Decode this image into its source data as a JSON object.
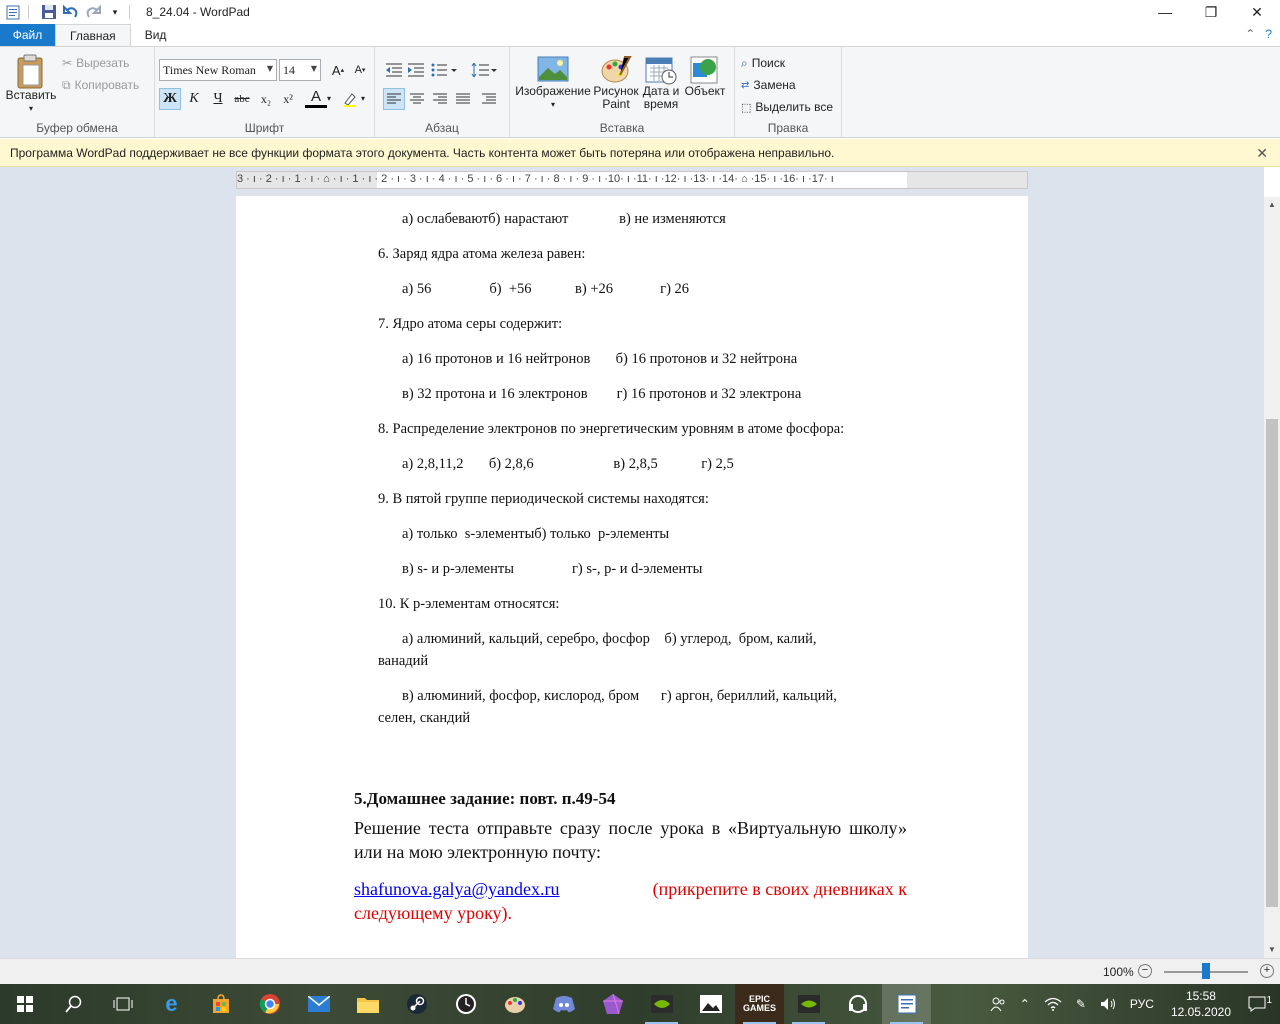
{
  "window": {
    "title": "8_24.04 - WordPad",
    "minimize": "—",
    "maximize": "❐",
    "close": "✕"
  },
  "tabs": {
    "file": "Файл",
    "home": "Главная",
    "view": "Вид"
  },
  "ribbon": {
    "clipboard": {
      "label": "Буфер обмена",
      "paste": "Вставить",
      "cut": "Вырезать",
      "copy": "Копировать"
    },
    "font": {
      "label": "Шрифт",
      "family": "Times New Roman",
      "size": "14",
      "bold": "Ж",
      "italic": "К",
      "underline": "Ч",
      "strike": "abc",
      "subscript": "x₂",
      "superscript": "x²",
      "color_letter": "A"
    },
    "paragraph": {
      "label": "Абзац"
    },
    "insert": {
      "label": "Вставка",
      "image": "Изображение",
      "paint_line1": "Рисунок",
      "paint_line2": "Paint",
      "datetime_line1": "Дата и",
      "datetime_line2": "время",
      "object": "Объект"
    },
    "editing": {
      "label": "Правка",
      "find": "Поиск",
      "replace": "Замена",
      "select_all": "Выделить все"
    }
  },
  "infobar": {
    "message": "Программа WordPad поддерживает не все функции формата этого документа. Часть контента может быть потеряна или отображена неправильно.",
    "close": "✕"
  },
  "ruler": {
    "text": "3 · ı · 2 · ı · 1 · ı · ⌂ · ı · 1 · ı · 2 · ı · 3 · ı · 4 · ı · 5 · ı · 6 · ı · 7 · ı · 8 · ı · 9 · ı ·10· ı ·11· ı ·12· ı ·13· ı ·14· ⌂ ·15· ı ·16· ı ·17· ı"
  },
  "document": {
    "lines": [
      "а) ослабеваютб) нарастают              в) не изменяются",
      "6. Заряд ядра атома железа равен:",
      "а) 56                б)  +56            в) +26             г) 26",
      "7. Ядро атома серы содержит:",
      "а) 16 протонов и 16 нейтронов       б) 16 протонов и 32 нейтрона",
      "в) 32 протона и 16 электронов        г) 16 протонов и 32 электрона",
      "8. Распределение электронов по энергетическим уровням в атоме фосфора:",
      "а) 2,8,11,2       б) 2,8,6                      в) 2,8,5            г) 2,5",
      "9. В пятой группе периодической системы находятся:",
      "а) только  s-элементыб) только  p-элементы",
      "в) s- и p-элементы                г) s-, p- и d-элементы",
      "10. К p-элементам относятся:",
      "а) алюминий, кальций, серебро, фосфор    б) углерод,  бром, калий,",
      "ванадий",
      "в) алюминий, фосфор, кислород, бром      г) аргон, бериллий, кальций,",
      "селен, скандий"
    ],
    "homework_title": "5.Домашнее задание: повт. п.49-54",
    "homework_text": "Решение теста отправьте  сразу после урока  в «Виртуальную школу» или на мою электронную почту:",
    "email": "shafunova.galya@yandex.ru",
    "email_note_1": "(прикрепите в своих дневниках   к",
    "email_note_2": "следующему уроку)."
  },
  "status": {
    "zoom": "100%"
  },
  "taskbar": {
    "lang": "РУС",
    "time": "15:58",
    "date": "12.05.2020",
    "notifications": "1"
  },
  "colors": {
    "accent": "#1979ca",
    "infobar_bg": "#fff8d1",
    "workspace_bg": "#dde3ec",
    "link": "#0000ee",
    "note_red": "#e00000"
  }
}
